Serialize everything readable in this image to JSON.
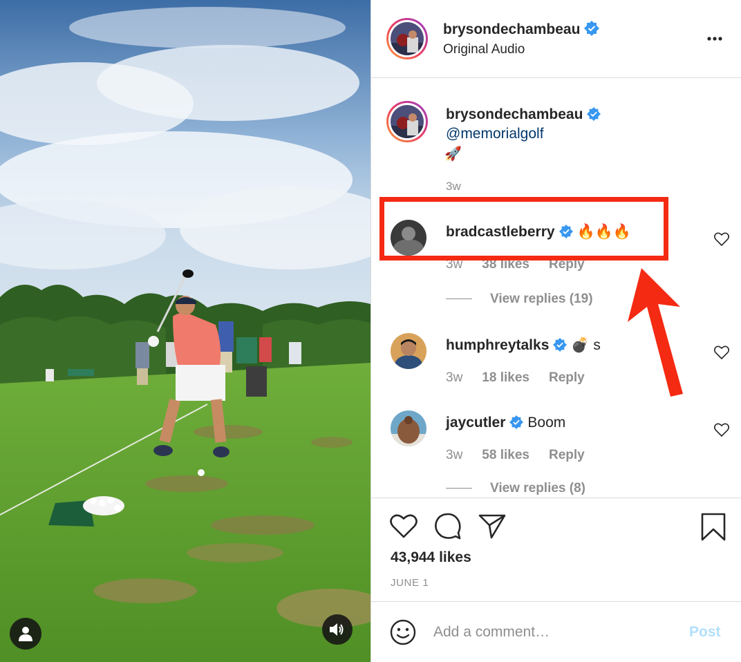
{
  "media": {
    "tag_icon": "person-icon",
    "audio_icon": "speaker-icon"
  },
  "header": {
    "username": "brysondechambeau",
    "verified": true,
    "audio": "Original Audio",
    "more_icon": "more-dots-icon"
  },
  "caption": {
    "username": "brysondechambeau",
    "mention": "@memorialgolf",
    "emoji": "🚀",
    "time": "3w"
  },
  "comments": [
    {
      "username": "bradcastleberry",
      "text": "🔥🔥🔥",
      "time": "3w",
      "likes": "38 likes",
      "reply": "Reply",
      "view_replies": "View replies (19)"
    },
    {
      "username": "humphreytalks",
      "text": "💣 s",
      "time": "3w",
      "likes": "18 likes",
      "reply": "Reply"
    },
    {
      "username": "jaycutler",
      "text": "Boom",
      "time": "3w",
      "likes": "58 likes",
      "reply": "Reply",
      "view_replies": "View replies (8)"
    }
  ],
  "actions": {
    "like_icon": "heart-icon",
    "comment_icon": "comment-bubble-icon",
    "share_icon": "paper-plane-icon",
    "save_icon": "bookmark-icon",
    "likes": "43,944 likes",
    "date": "JUNE 1"
  },
  "comment_box": {
    "emoji_icon": "smiley-icon",
    "placeholder": "Add a comment…",
    "post_label": "Post"
  },
  "colors": {
    "verified": "#3897f0",
    "link": "#00376b",
    "muted": "#8e8e8e",
    "post_disabled": "#b2dffc",
    "annotation": "#f42a12"
  }
}
